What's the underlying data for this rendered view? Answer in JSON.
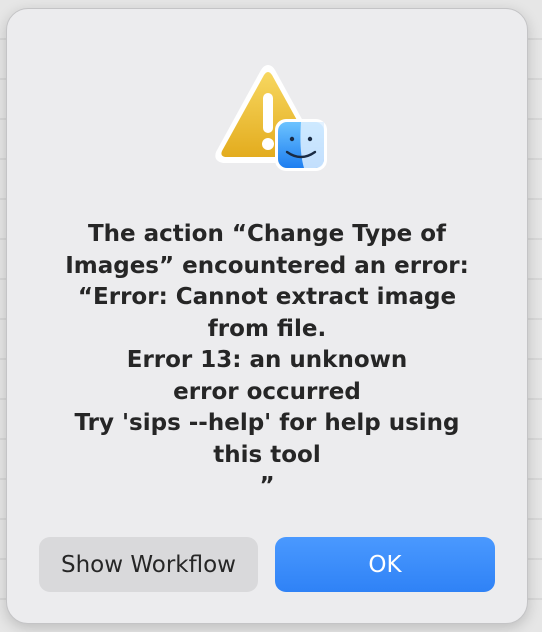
{
  "dialog": {
    "message": "The action “Change Type of\nImages” encountered an error:\n“Error: Cannot extract image\nfrom file.\nError 13: an unknown\nerror occurred\nTry 'sips --help' for help using\nthis tool\n”",
    "icon": "warning-triangle-finder-icon",
    "buttons": {
      "secondary_label": "Show Workflow",
      "primary_label": "OK"
    }
  },
  "colors": {
    "primary_button": "#2f82f6",
    "secondary_button": "#d9d9db",
    "dialog_background": "#ececee",
    "warning_yellow": "#f1c232"
  }
}
